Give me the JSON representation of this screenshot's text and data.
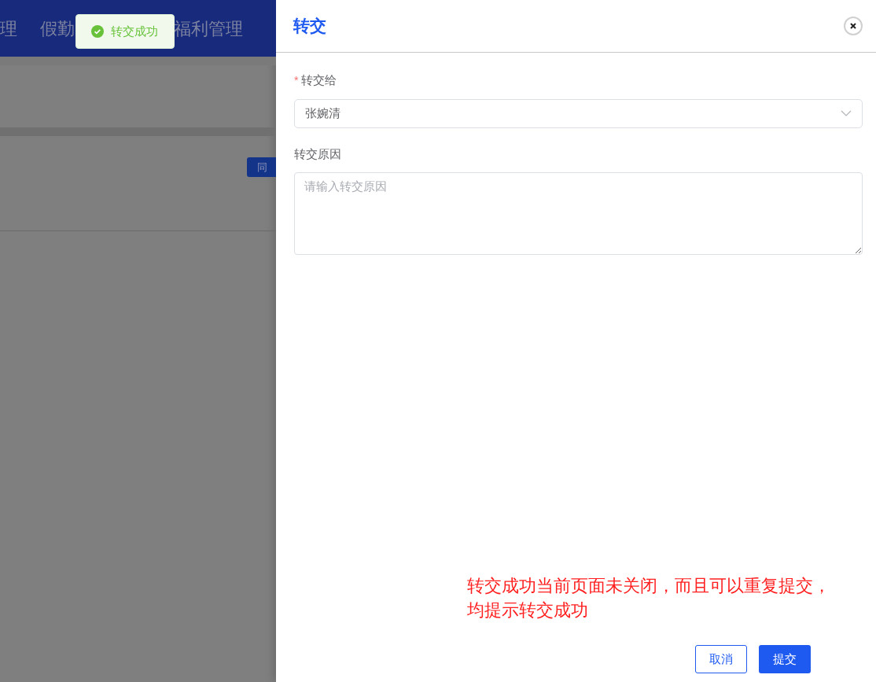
{
  "nav": {
    "items": [
      {
        "label": "理"
      },
      {
        "label": "假勤"
      },
      {
        "label": "福利管理"
      }
    ]
  },
  "page": {
    "button": "同"
  },
  "toast": {
    "kind": "success",
    "text": "转交成功"
  },
  "drawer": {
    "title": "转交",
    "fields": [
      {
        "kind": "select",
        "label": "转交给",
        "required_mark": "*",
        "value": "张婉清"
      },
      {
        "kind": "textarea",
        "label": "转交原因",
        "placeholder": "请输入转交原因"
      }
    ],
    "annotation": [
      "转交成功当前页面未关闭，而且可以重复提交，",
      "均提示转交成功"
    ],
    "buttons": [
      {
        "kind": "secondary",
        "label": "取消"
      },
      {
        "kind": "primary",
        "label": "提交"
      }
    ]
  }
}
